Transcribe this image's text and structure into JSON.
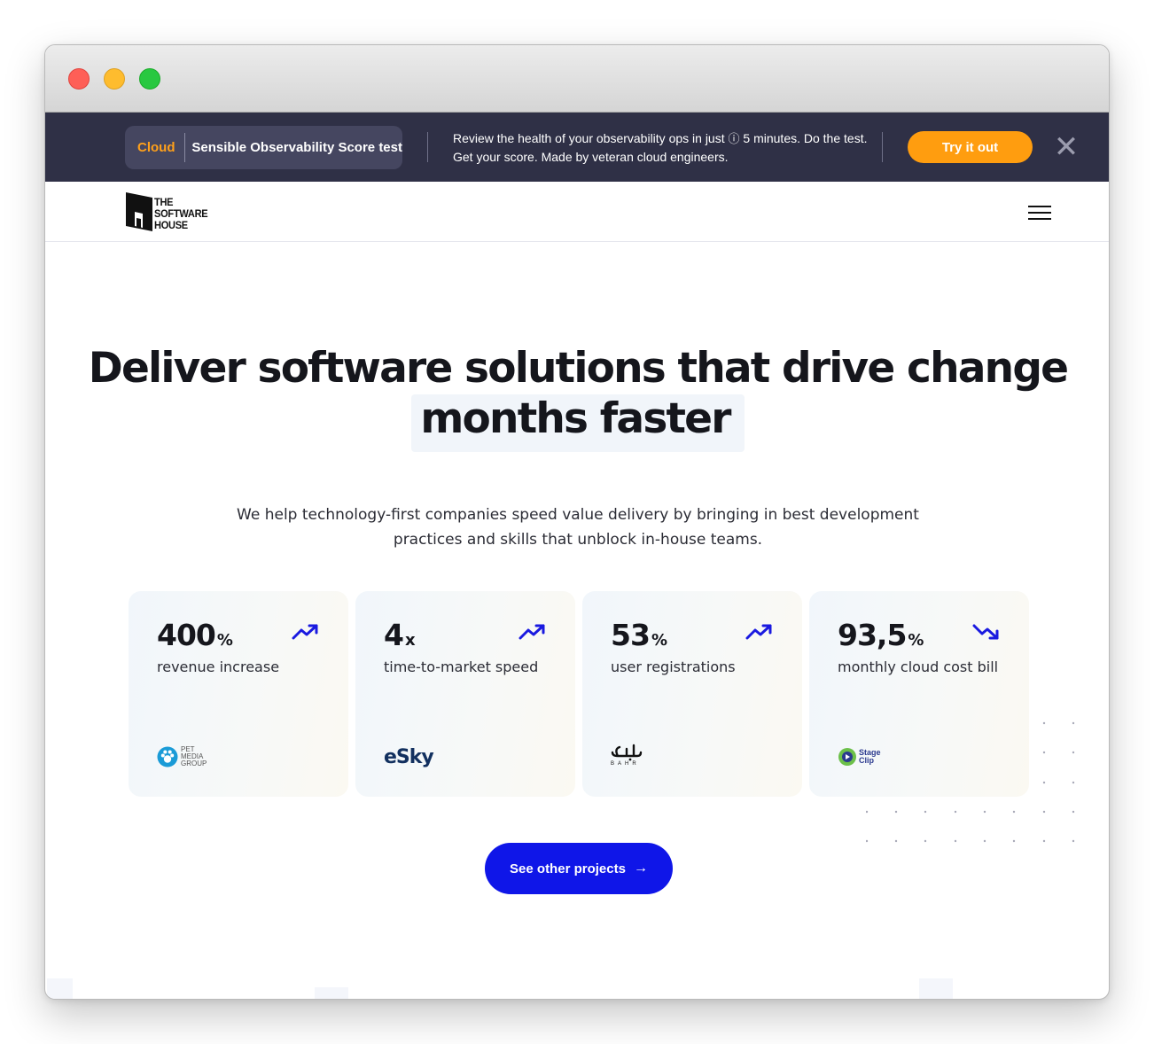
{
  "promo": {
    "chip_cloud": "Cloud",
    "chip_title": "Sensible Observability Score test",
    "text_before": "Review the health of your observability ops in just",
    "text_after": "5 minutes. Do the test. Get your score. Made by veteran cloud engineers.",
    "cta": "Try it out",
    "close_icon": "close-icon"
  },
  "nav": {
    "logo_lines": [
      "THE",
      "SOFTWARE",
      "HOUSE"
    ],
    "menu_icon": "hamburger-icon"
  },
  "hero": {
    "title_part1": "Deliver software solutions that drive change",
    "title_highlight": "months faster",
    "subtitle": "We help technology-first companies speed value delivery by bringing in best development practices and skills that unblock in-house teams."
  },
  "stats": [
    {
      "number": "400",
      "unit": "%",
      "label": "revenue increase",
      "trend": "up",
      "client": "PET MEDIA GROUP"
    },
    {
      "number": "4",
      "unit": "x",
      "label": "time-to-market speed",
      "trend": "up",
      "client": "eSky"
    },
    {
      "number": "53",
      "unit": "%",
      "label": "user registrations",
      "trend": "up",
      "client": "BAHR"
    },
    {
      "number": "93,5",
      "unit": "%",
      "label": "monthly cloud cost bill",
      "trend": "down",
      "client": "Stage Clip"
    }
  ],
  "cta": {
    "label": "See other projects",
    "arrow": "→"
  },
  "colors": {
    "promo_bg": "#2f3046",
    "accent_orange": "#ff9d0f",
    "accent_blue": "#0f16e8"
  }
}
